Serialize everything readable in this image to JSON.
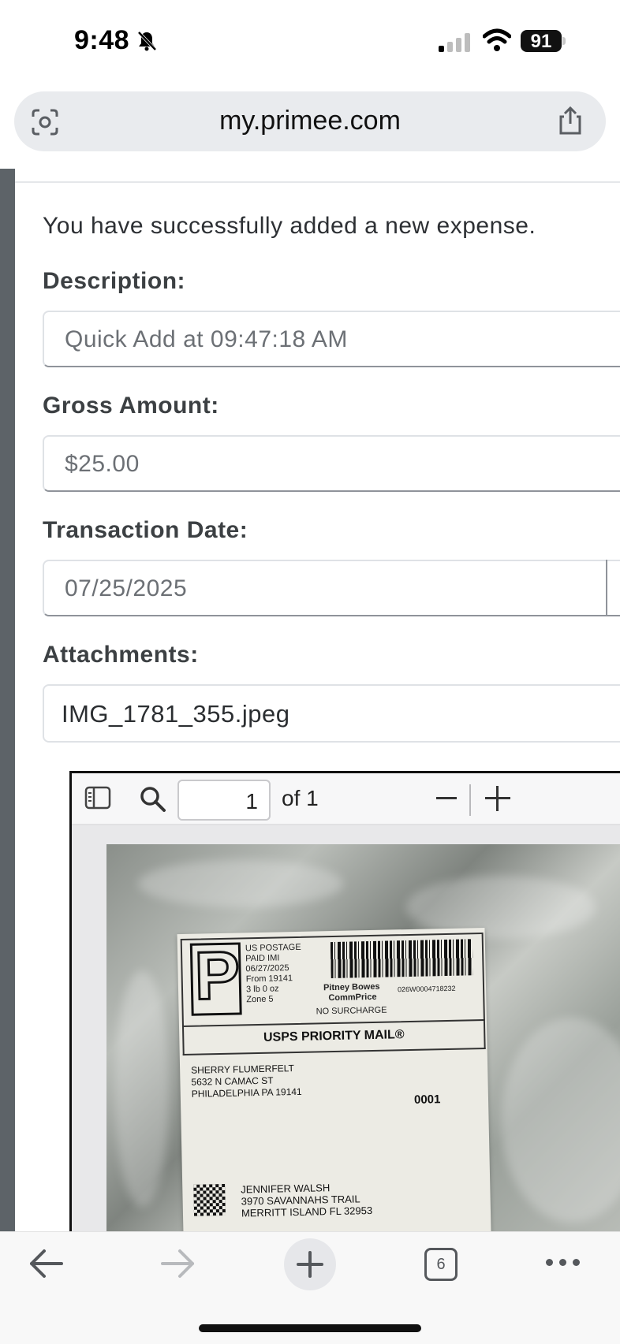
{
  "status_bar": {
    "time": "9:48",
    "battery": "91"
  },
  "browser": {
    "url": "my.primee.com"
  },
  "form": {
    "success_message": "You have successfully added a new expense.",
    "description_label": "Description:",
    "description_value": "Quick Add at 09:47:18 AM",
    "gross_amount_label": "Gross Amount:",
    "gross_amount_value": "$25.00",
    "transaction_date_label": "Transaction Date:",
    "transaction_date_value": "07/25/2025",
    "attachments_label": "Attachments:",
    "attachment_filename": "IMG_1781_355.jpeg"
  },
  "pdf_viewer": {
    "page_number": "1",
    "page_total_text": "of 1"
  },
  "shipping_label": {
    "postage_text": "US POSTAGE\nPAID IMI\n06/27/2025\nFrom 19141\n3 lb 0 oz\nZone 5",
    "carrier_text": "Pitney Bowes\n  CommPrice",
    "surcharge_text": "NO SURCHARGE",
    "tracking_code": "026W0004718232",
    "service": "USPS PRIORITY MAIL®",
    "sender": "SHERRY FLUMERFELT\n5632 N CAMAC ST\nPHILADELPHIA PA 19141",
    "code": "0001",
    "recipient": "JENNIFER WALSH\n3970 SAVANNAHS TRAIL\nMERRITT ISLAND FL 32953"
  },
  "bottom_bar": {
    "tab_count": "6"
  }
}
